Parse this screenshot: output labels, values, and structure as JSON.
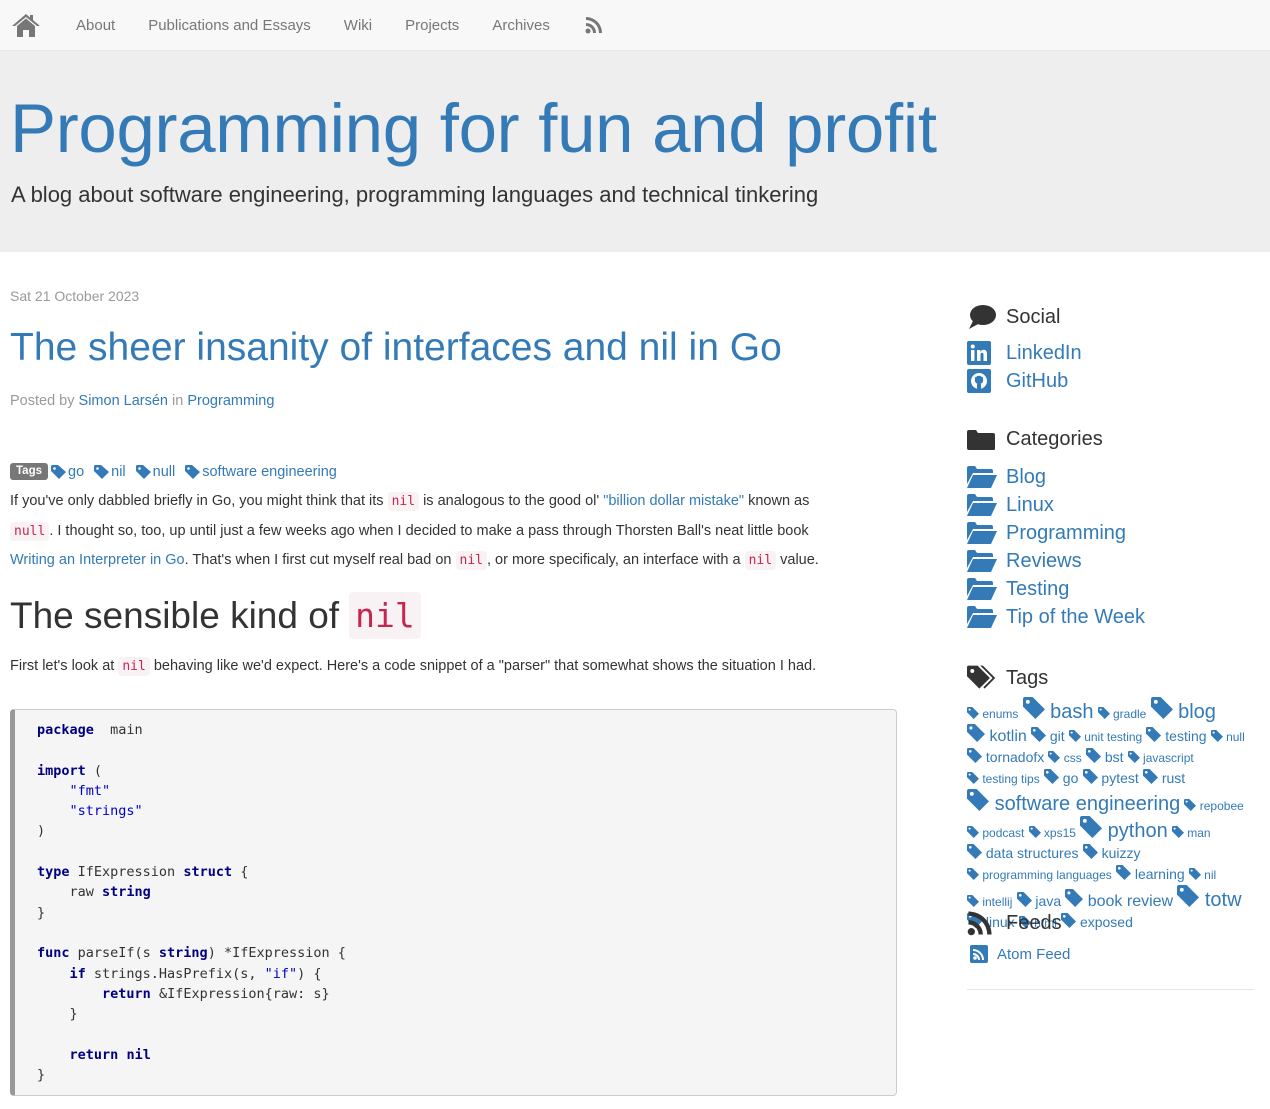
{
  "nav": {
    "home_icon": "home-icon",
    "links": [
      "About",
      "Publications and Essays",
      "Wiki",
      "Projects",
      "Archives"
    ],
    "rss_icon": "rss-icon"
  },
  "header": {
    "title": "Programming for fun and profit",
    "subtitle": "A blog about software engineering, programming languages and technical tinkering"
  },
  "article": {
    "date": "Sat 21 October 2023",
    "title": "The sheer insanity of interfaces and nil in Go",
    "posted_by_prefix": "Posted by",
    "author": "Simon Larsén",
    "in_word": "in",
    "category": "Programming",
    "tags_label": "Tags",
    "tags": [
      "go",
      "nil",
      "null",
      "software engineering"
    ],
    "intro": {
      "t1": "If you've only dabbled briefly in Go, you might think that its",
      "c1": "nil",
      "t2": "is analogous to the good ol'",
      "link1": "\"billion dollar mistake\"",
      "t3": "known as",
      "c2": "null",
      "t4": ". I thought so, too, up until just a few weeks ago when I decided to make a pass through Thorsten Ball's neat little book",
      "link2": "Writing an Interpreter in Go",
      "t5": ". That's when I first cut myself real bad on",
      "c3": "nil",
      "t6": ", or more specificaly, an interface with a",
      "c4": "nil",
      "t7": "value."
    },
    "section_heading": "The sensible kind of",
    "section_heading_code": "nil",
    "para2": {
      "t1": "First let's look at",
      "c1": "nil",
      "t2": "behaving like we'd expect. Here's a code snippet of a \"parser\" that somewhat shows the situation I had."
    },
    "code_lines": [
      [
        [
          "kw",
          "package"
        ],
        [
          "",
          "  main"
        ]
      ],
      [],
      [
        [
          "kw",
          "import"
        ],
        [
          "",
          " ("
        ]
      ],
      [
        [
          "",
          "    "
        ],
        [
          "str",
          "\"fmt\""
        ]
      ],
      [
        [
          "",
          "    "
        ],
        [
          "str",
          "\"strings\""
        ]
      ],
      [
        [
          "",
          ")"
        ]
      ],
      [],
      [
        [
          "kw",
          "type"
        ],
        [
          "",
          " IfExpression "
        ],
        [
          "kw",
          "struct"
        ],
        [
          "",
          " {"
        ]
      ],
      [
        [
          "",
          "    raw "
        ],
        [
          "kw",
          "string"
        ]
      ],
      [
        [
          "",
          "}"
        ]
      ],
      [],
      [
        [
          "kw",
          "func"
        ],
        [
          "",
          " parseIf(s "
        ],
        [
          "kw",
          "string"
        ],
        [
          "",
          ") *IfExpression {"
        ]
      ],
      [
        [
          "",
          "    "
        ],
        [
          "kw",
          "if"
        ],
        [
          "",
          " strings.HasPrefix(s, "
        ],
        [
          "str",
          "\"if\""
        ],
        [
          "",
          ") {"
        ]
      ],
      [
        [
          "",
          "        "
        ],
        [
          "kw",
          "return"
        ],
        [
          "",
          " &IfExpression{raw: s}"
        ]
      ],
      [
        [
          "",
          "    }"
        ]
      ],
      [],
      [
        [
          "",
          "    "
        ],
        [
          "kw",
          "return"
        ],
        [
          "",
          " "
        ],
        [
          "kw",
          "nil"
        ]
      ],
      [
        [
          "",
          "}"
        ]
      ]
    ]
  },
  "sidebar": {
    "social": {
      "heading": "Social",
      "items": [
        "LinkedIn",
        "GitHub"
      ]
    },
    "categories": {
      "heading": "Categories",
      "items": [
        "Blog",
        "Linux",
        "Programming",
        "Reviews",
        "Testing",
        "Tip of the Week"
      ]
    },
    "tags": {
      "heading": "Tags",
      "items": [
        {
          "label": "enums",
          "size": 1
        },
        {
          "label": "bash",
          "size": 4
        },
        {
          "label": "gradle",
          "size": 1
        },
        {
          "label": "blog",
          "size": 4
        },
        {
          "label": "kotlin",
          "size": 3
        },
        {
          "label": "git",
          "size": 2
        },
        {
          "label": "unit testing",
          "size": 1
        },
        {
          "label": "testing",
          "size": 2
        },
        {
          "label": "null",
          "size": 1
        },
        {
          "label": "tornadofx",
          "size": 2
        },
        {
          "label": "css",
          "size": 1
        },
        {
          "label": "bst",
          "size": 2
        },
        {
          "label": "javascript",
          "size": 1
        },
        {
          "label": "testing tips",
          "size": 1
        },
        {
          "label": "go",
          "size": 2
        },
        {
          "label": "pytest",
          "size": 2
        },
        {
          "label": "rust",
          "size": 2
        },
        {
          "label": "software engineering",
          "size": 4
        },
        {
          "label": "repobee",
          "size": 1
        },
        {
          "label": "podcast",
          "size": 1
        },
        {
          "label": "xps15",
          "size": 1
        },
        {
          "label": "python",
          "size": 4
        },
        {
          "label": "man",
          "size": 1
        },
        {
          "label": "data structures",
          "size": 2
        },
        {
          "label": "kuizzy",
          "size": 2
        },
        {
          "label": "programming languages",
          "size": 1
        },
        {
          "label": "learning",
          "size": 2
        },
        {
          "label": "nil",
          "size": 1
        },
        {
          "label": "intellij",
          "size": 1
        },
        {
          "label": "java",
          "size": 2
        },
        {
          "label": "book review",
          "size": 3
        },
        {
          "label": "totw",
          "size": 4
        },
        {
          "label": "linux",
          "size": 2
        },
        {
          "label": "html",
          "size": 1
        },
        {
          "label": "exposed",
          "size": 2
        }
      ]
    },
    "feeds": {
      "heading": "Feeds",
      "items": [
        "Atom Feed"
      ]
    }
  },
  "colors": {
    "link": "#337ab7",
    "nav_bg": "#f8f8f8",
    "jumbotron_bg": "#eeeeee",
    "code_inline": "#c7254e",
    "code_keyword": "#000080",
    "code_string": "#0000cc"
  }
}
